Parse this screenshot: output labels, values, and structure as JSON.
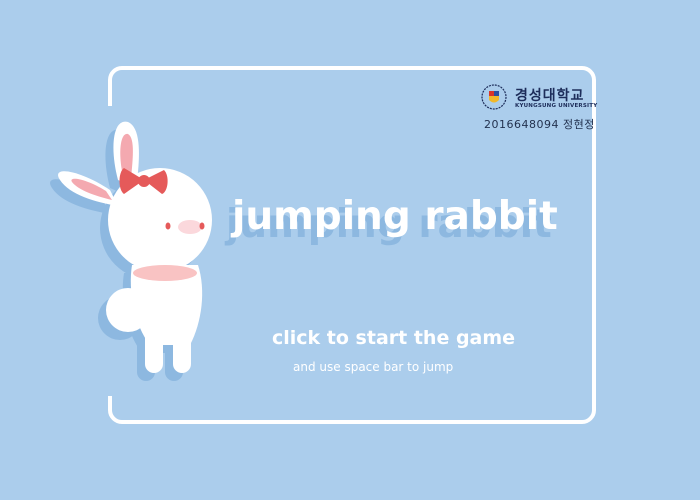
{
  "colors": {
    "background": "#abcdec",
    "frame": "#ffffff",
    "title_shadow": "#8db8e0",
    "ribbon": "#e55a5a",
    "ear_inner": "#f4a9b0"
  },
  "university": {
    "name_ko": "경성대학교",
    "name_en": "KYUNGSUNG UNIVERSITY"
  },
  "student_info": "2016648094 정현정",
  "title": "jumping rabbit",
  "start_prompt": "click to start the game",
  "instructions": "and use space bar to jump",
  "icons": {
    "rabbit": "rabbit-character",
    "emblem": "university-emblem-icon"
  }
}
